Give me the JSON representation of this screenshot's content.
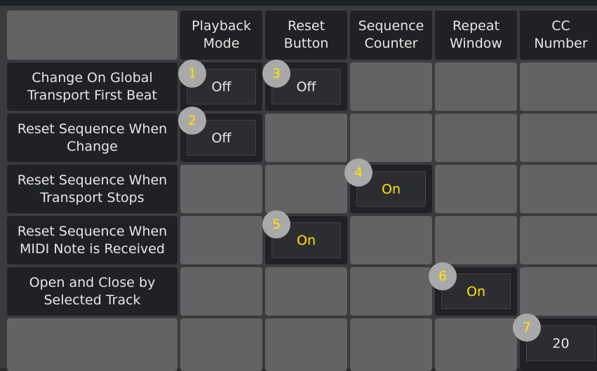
{
  "columns": [
    "Playback\nMode",
    "Reset\nButton",
    "Sequence\nCounter",
    "Repeat\nWindow",
    "CC\nNumber"
  ],
  "rows": [
    "Change On Global\nTransport First Beat",
    "Reset Sequence When\nChange",
    "Reset Sequence When\nTransport Stops",
    "Reset Sequence When\nMIDI Note is Received",
    "Open and Close by\nSelected Track",
    ""
  ],
  "controls": [
    {
      "badge": "1",
      "value": "Off",
      "state": "off"
    },
    {
      "badge": "2",
      "value": "Off",
      "state": "off"
    },
    {
      "badge": "3",
      "value": "Off",
      "state": "off"
    },
    {
      "badge": "4",
      "value": "On",
      "state": "on"
    },
    {
      "badge": "5",
      "value": "On",
      "state": "on"
    },
    {
      "badge": "6",
      "value": "On",
      "state": "on"
    },
    {
      "badge": "7",
      "value": "20",
      "state": "off"
    }
  ],
  "colors": {
    "background": "#3a3b3d",
    "cell": "#626365",
    "cell_active": "#1f2124",
    "button": "#2b2d30",
    "on_text": "#ffe600",
    "badge": "#a9a9a9"
  }
}
